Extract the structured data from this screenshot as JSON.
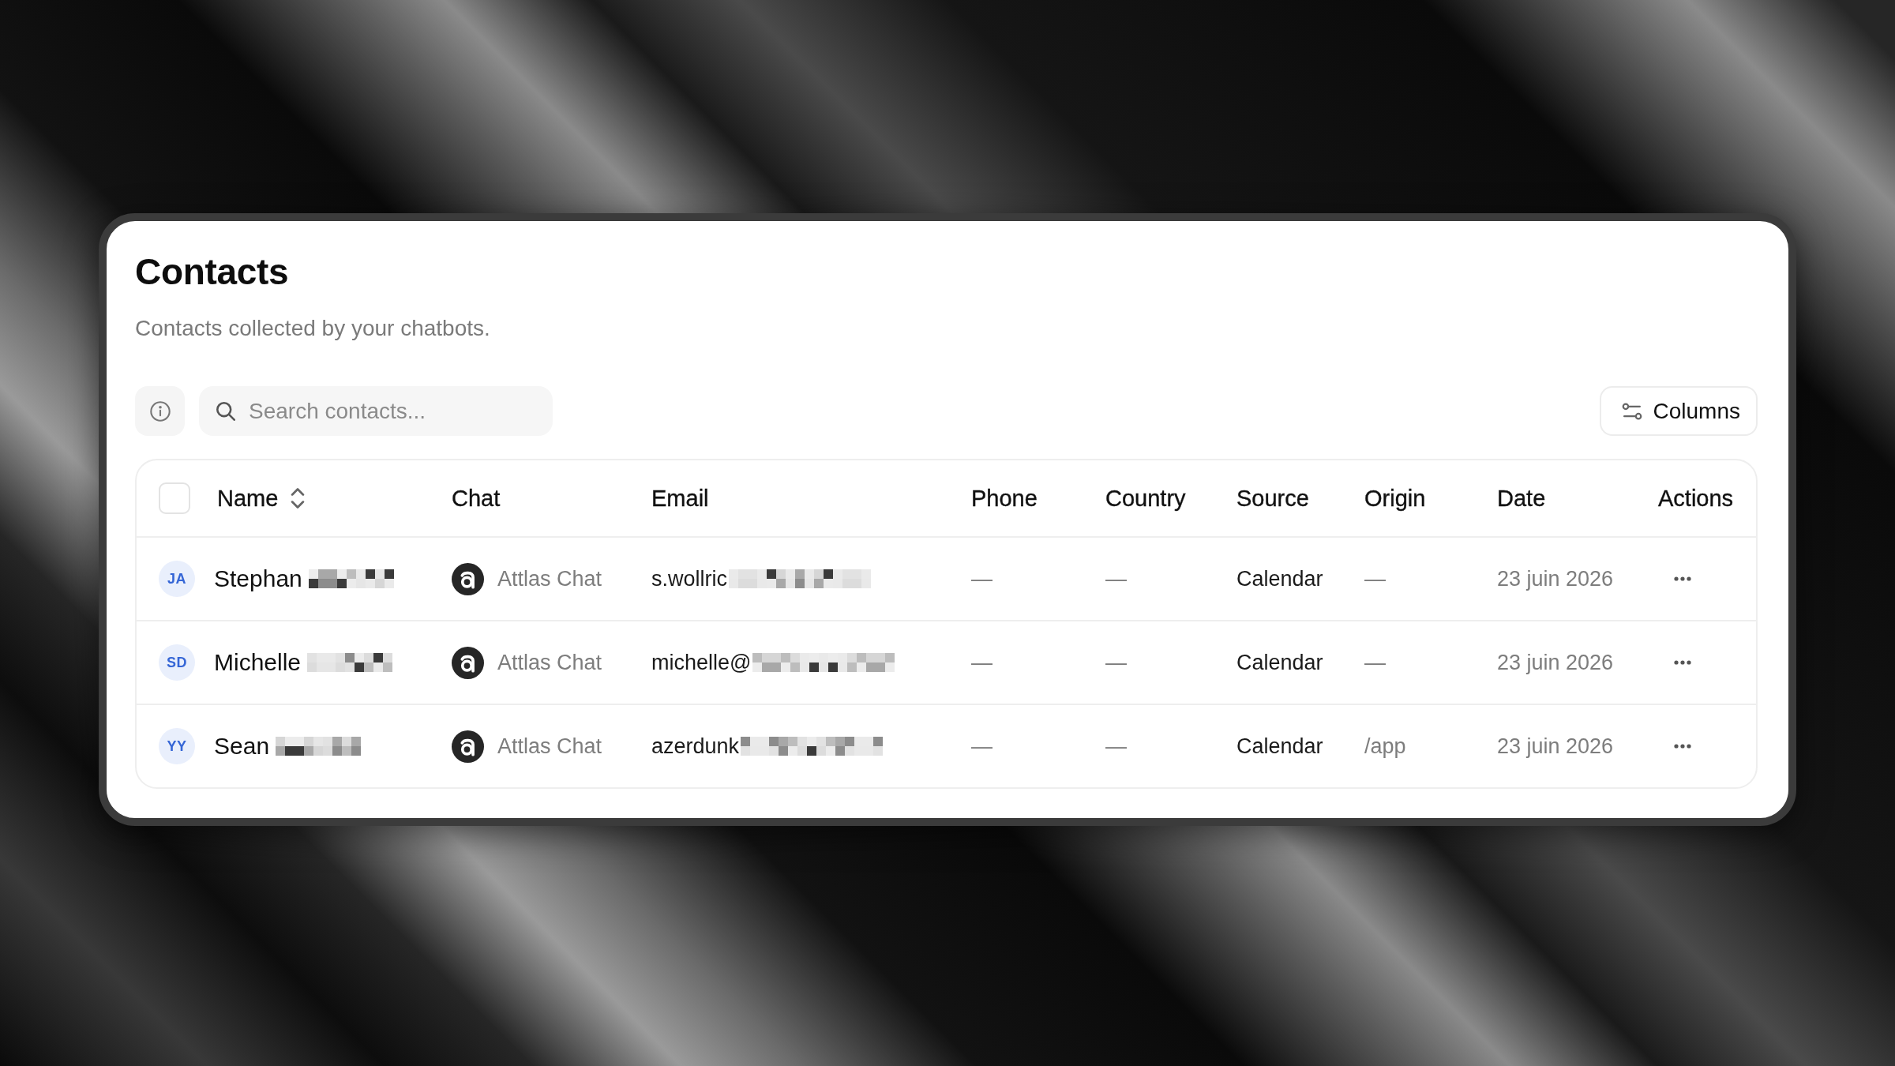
{
  "page": {
    "title": "Contacts",
    "subtitle": "Contacts collected by your chatbots."
  },
  "toolbar": {
    "search": {
      "placeholder": "Search contacts..."
    },
    "columns_button": "Columns"
  },
  "table": {
    "select_all": {
      "checked": false
    },
    "columns": [
      {
        "label": "Name",
        "sortable": true
      },
      {
        "label": "Chat",
        "sortable": false
      },
      {
        "label": "Email",
        "sortable": false
      },
      {
        "label": "Phone",
        "sortable": false
      },
      {
        "label": "Country",
        "sortable": false
      },
      {
        "label": "Source",
        "sortable": false
      },
      {
        "label": "Origin",
        "sortable": false
      },
      {
        "label": "Date",
        "sortable": false
      },
      {
        "label": "Actions",
        "sortable": false
      }
    ],
    "rows": [
      {
        "initials": "JA",
        "name": "Stephan",
        "name_redacted": true,
        "chat": "Attlas Chat",
        "email": "s.wollric",
        "email_redacted": true,
        "phone": "—",
        "country": "—",
        "source": "Calendar",
        "origin": "—",
        "date": "23 juin 2026"
      },
      {
        "initials": "SD",
        "name": "Michelle",
        "name_redacted": true,
        "chat": "Attlas Chat",
        "email": "michelle@",
        "email_redacted": true,
        "phone": "—",
        "country": "—",
        "source": "Calendar",
        "origin": "—",
        "date": "23 juin 2026"
      },
      {
        "initials": "YY",
        "name": "Sean",
        "name_redacted": true,
        "chat": "Attlas Chat",
        "email": "azerdunk",
        "email_redacted": true,
        "phone": "—",
        "country": "—",
        "source": "Calendar",
        "origin": "/app",
        "date": "23 juin 2026"
      }
    ]
  }
}
